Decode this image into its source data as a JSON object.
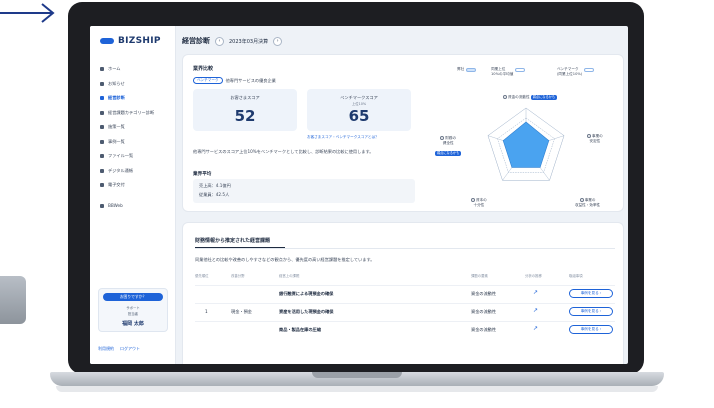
{
  "app": {
    "logo_text": "BIZSHIP"
  },
  "sidebar": {
    "items": [
      {
        "label": "ホーム",
        "icon": "home-icon",
        "active": false
      },
      {
        "label": "お知らせ",
        "icon": "bell-icon",
        "active": false
      },
      {
        "label": "経営診断",
        "icon": "chart-icon",
        "active": true
      },
      {
        "label": "経営課題カテゴリー診断",
        "icon": "list-icon",
        "active": false
      },
      {
        "label": "施策一覧",
        "icon": "star-icon",
        "active": false
      },
      {
        "label": "事例一覧",
        "icon": "book-icon",
        "active": false
      },
      {
        "label": "ファイル一覧",
        "icon": "folder-icon",
        "active": false
      },
      {
        "label": "デジタル通帳",
        "icon": "wallet-icon",
        "active": false
      },
      {
        "label": "電子交付",
        "icon": "document-icon",
        "active": false
      },
      {
        "label": "BBWeb",
        "icon": "external-icon",
        "active": false
      }
    ],
    "help": {
      "button": "お困りですか？",
      "line1": "サポート",
      "line2": "担当者",
      "name": "福岡 太郎"
    },
    "footer_links": [
      "利用規約",
      "ログアウト"
    ]
  },
  "header": {
    "title": "経営診断",
    "prev": "‹",
    "period": "2023年03月決算",
    "next": "›"
  },
  "comparison": {
    "section_title": "業界比較",
    "industry_tag": "ベンチマーク",
    "industry_text": "他専門サービスの優良企業",
    "customer_score_label": "お客さまスコア",
    "customer_score": "52",
    "benchmark_label": "ベンチマークスコア",
    "benchmark_sub": "上位10%",
    "benchmark_score": "65",
    "benchmark_link": "お客さまスコア・ベンチマークスコアとは？",
    "description": "他専門サービスのスコア上位10%をベンチマークとして比較し、診断結果の比較に使用します。",
    "avg_title": "業界平均",
    "avg_sales": "売上高：4.1億円",
    "avg_employees": "従業員：42.5人"
  },
  "radar": {
    "legend": [
      {
        "label": "弊社"
      },
      {
        "label": "同業上位\n10%の平均値"
      },
      {
        "label": "ベンチマーク\n(同業上位10%)"
      }
    ],
    "axes": [
      {
        "label": "資金の流動性",
        "badge": "弱点になるかも"
      },
      {
        "label": "事業の\n安定性",
        "badge": ""
      },
      {
        "label": "事業の\n収益性・効率性",
        "badge": ""
      },
      {
        "label": "資本の\n十分性",
        "badge": ""
      },
      {
        "label": "財務の\n健全性",
        "badge": "弱点になるかも"
      }
    ],
    "values": [
      0.65,
      0.6,
      0.6,
      0.6,
      0.6
    ],
    "colors": {
      "fill": "#4aa3f0",
      "grid": "#9db0c8"
    }
  },
  "issues": {
    "title": "財務情報から推定された経営課題",
    "description": "同業他社との比較や改善のしやすさなどの観点から、優先度の高い経営課題を推定しています。",
    "headers": [
      "優先順位",
      "改善分野",
      "経営上の課題",
      "課題の要素",
      "分析の推移",
      "取組事項"
    ],
    "rows": [
      {
        "rank": "",
        "area": "",
        "issue": "銀行融資による現預金の確保",
        "element": "資金の流動性",
        "trend": "↗",
        "button": "事例を見る ›"
      },
      {
        "rank": "1",
        "area": "現金・預金",
        "issue": "資産を活用した現預金の確保",
        "element": "資金の流動性",
        "trend": "↗",
        "button": "事例を見る ›"
      },
      {
        "rank": "",
        "area": "",
        "issue": "商品・製品在庫の圧縮",
        "element": "資金の流動性",
        "trend": "↗",
        "button": "事例を見る ›"
      }
    ]
  }
}
